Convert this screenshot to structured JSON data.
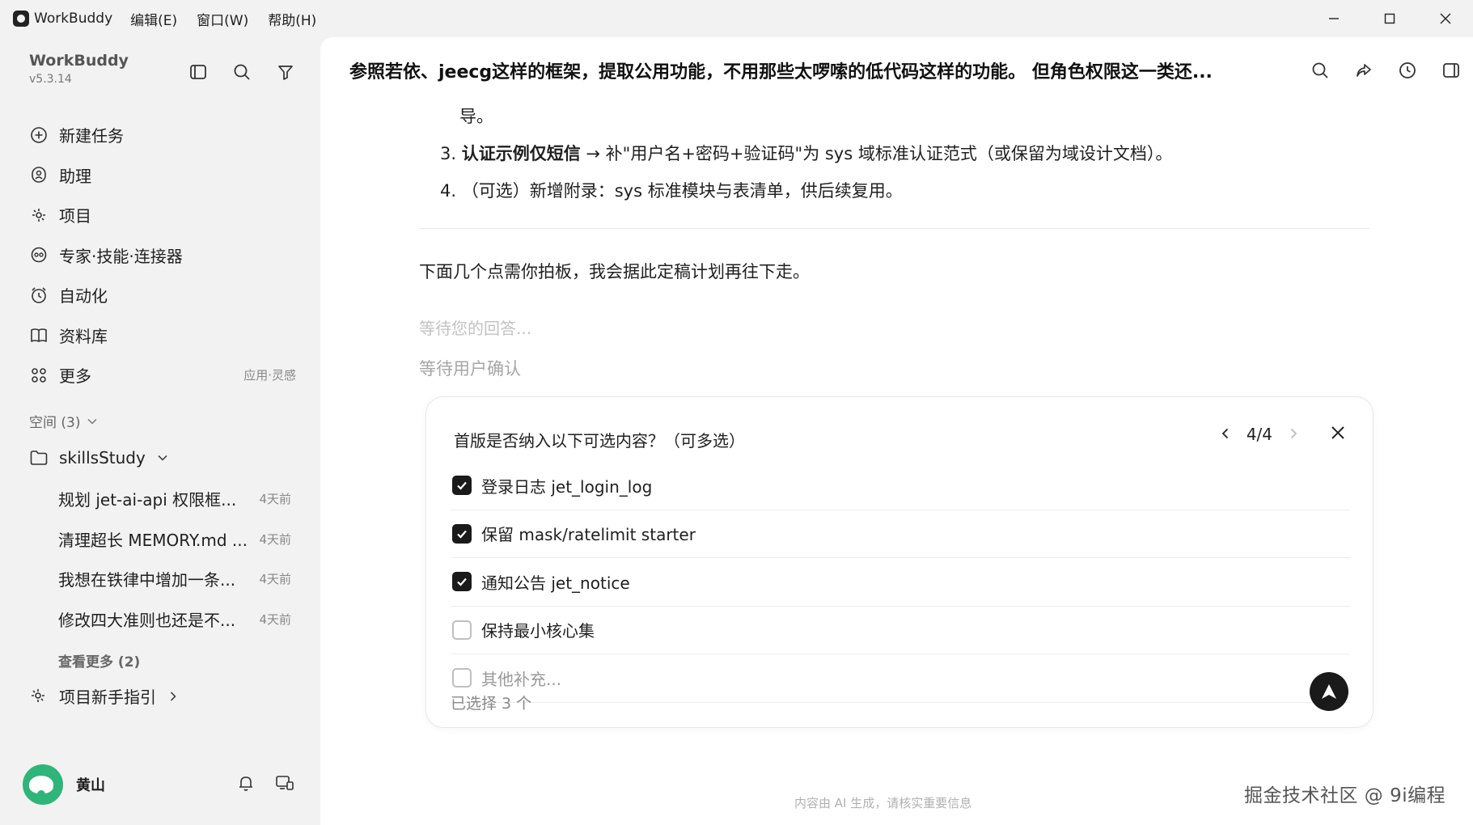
{
  "titlebar": {
    "app_name": "WorkBuddy",
    "menus": [
      "编辑(E)",
      "窗口(W)",
      "帮助(H)"
    ],
    "min_glyph": "—",
    "max_glyph": "☐",
    "close_glyph": "✕"
  },
  "sidebar": {
    "brand": "WorkBuddy",
    "version": "v5.3.14",
    "nav": [
      {
        "label": "新建任务",
        "icon": "plus-circle-icon"
      },
      {
        "label": "助理",
        "icon": "assistant-icon"
      },
      {
        "label": "项目",
        "icon": "project-icon"
      },
      {
        "label": "专家·技能·连接器",
        "icon": "expert-icon"
      },
      {
        "label": "自动化",
        "icon": "automation-icon"
      },
      {
        "label": "资料库",
        "icon": "library-icon"
      },
      {
        "label": "更多",
        "icon": "more-grid-icon",
        "extra": "应用·灵感"
      }
    ],
    "space_header": "空间 (3)",
    "folder": "skillsStudy",
    "threads": [
      {
        "title": "规划 jet-ai-api 权限框...",
        "date": "4天前"
      },
      {
        "title": "清理超长 MEMORY.md ...",
        "date": "4天前"
      },
      {
        "title": "我想在铁律中增加一条...",
        "date": "4天前"
      },
      {
        "title": "修改四大准则也还是不...",
        "date": "4天前"
      }
    ],
    "see_more": "查看更多 (2)",
    "guide": "项目新手指引",
    "user_name": "黄山"
  },
  "main": {
    "title": "参照若依、jeecg这样的框架，提取公用功能，不用那些太啰嗦的低代码这样的功能。 但角色权限这一类还...",
    "line_tail": "导。",
    "item3_num": "3.",
    "item3_bold": "认证示例仅短信",
    "item3_rest": " → 补\"用户名+密码+验证码\"为 sys 域标准认证范式（或保留为域设计文档）。",
    "item4": "4. （可选）新增附录：sys 标准模块与表清单，供后续复用。",
    "paragraph": "下面几个点需你拍板，我会据此定稿计划再往下走。",
    "waiting_answer": "等待您的回答...",
    "waiting_confirm": "等待用户确认"
  },
  "question": {
    "title": "首版是否纳入以下可选内容？（可多选）",
    "page": "4/4",
    "options": [
      {
        "label": "登录日志 jet_login_log",
        "checked": true
      },
      {
        "label": "保留 mask/ratelimit starter",
        "checked": true
      },
      {
        "label": "通知公告 jet_notice",
        "checked": true
      },
      {
        "label": "保持最小核心集",
        "checked": false
      },
      {
        "label": "其他补充...",
        "checked": false
      }
    ],
    "selected_count": "已选择 3 个"
  },
  "footer_note": "内容由 AI 生成，请核实重要信息",
  "watermark": "掘金技术社区 @ 9i编程"
}
